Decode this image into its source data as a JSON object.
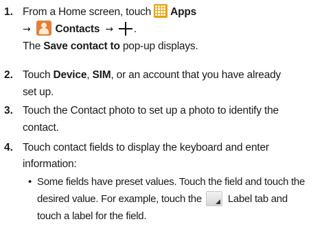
{
  "steps": [
    {
      "number": "1.",
      "line1_before": "From a Home screen, touch",
      "apps_label": "Apps",
      "contacts_label": "Contacts",
      "arrow": "→",
      "period": ".",
      "note_prefix": "The ",
      "note_bold": "Save contact to",
      "note_suffix": " pop-up displays."
    },
    {
      "number": "2.",
      "prefix": "Touch ",
      "device": "Device",
      "comma": ", ",
      "sim": "SIM",
      "line1_suffix": ", or an account that you have already",
      "line2": "set up."
    },
    {
      "number": "3.",
      "line1": "Touch the Contact photo to set up a photo to identify the",
      "line2": "contact."
    },
    {
      "number": "4.",
      "line1": "Touch contact fields to display the keyboard and enter",
      "line2": "information:",
      "bullet": "•",
      "bullet_line1": "Some fields have preset values. Touch the field and touch the",
      "bullet_line2_before": "desired value. For example, touch the",
      "bullet_line2_after": "Label tab and",
      "bullet_line3": "touch a label for the field."
    }
  ],
  "icons": {
    "apps": "apps-icon",
    "contacts": "contacts-icon",
    "add": "plus-icon",
    "label_tab": "label-tab-icon"
  },
  "colors": {
    "apps_icon": "#e9a000",
    "contacts_icon": "#e0803a"
  }
}
